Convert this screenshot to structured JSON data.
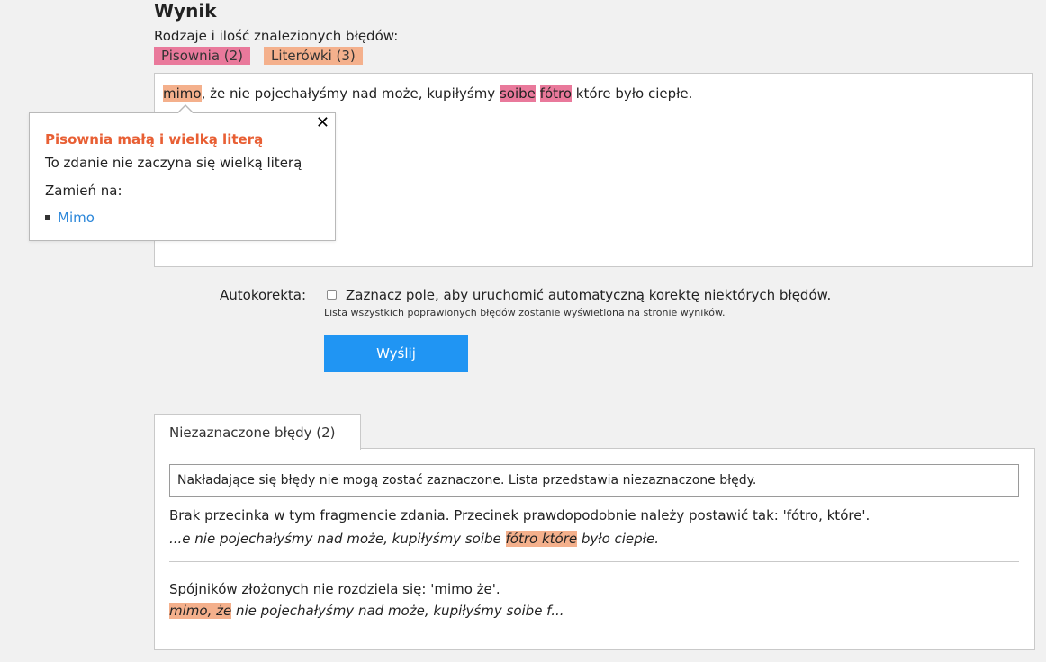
{
  "result": {
    "title": "Wynik",
    "subtitle": "Rodzaje i ilość znalezionych błędów:",
    "badges": {
      "pisownia": "Pisownia (2)",
      "literowki": "Literówki (3)"
    }
  },
  "editor": {
    "seg0": "mimo",
    "seg1": ", że nie pojechałyśmy nad może, kupiłyśmy ",
    "seg2": "soibe",
    "seg3": " ",
    "seg4": "fótro",
    "seg5": " które było ciepłe."
  },
  "popup": {
    "close": "✕",
    "title": "Pisownia małą i wielką literą",
    "message": "To zdanie nie zaczyna się wielką literą",
    "replace_label": "Zamień na:",
    "suggestion": "Mimo"
  },
  "autocorrect": {
    "label": "Autokorekta:",
    "checkbox_text": "Zaznacz pole, aby uruchomić automatyczną korektę niektórych błędów.",
    "note": "Lista wszystkich poprawionych błędów zostanie wyświetlona na stronie wyników."
  },
  "submit_label": "Wyślij",
  "unmarked": {
    "tab_label": "Niezaznaczone błędy (2)",
    "notice": "Nakładające się błędy nie mogą zostać zaznaczone. Lista przedstawia niezaznaczone błędy.",
    "issues": [
      {
        "title": "Brak przecinka w tym fragmencie zdania. Przecinek prawdopodobnie należy postawić tak: 'fótro, które'.",
        "before": "...e nie pojechałyśmy nad może, kupiłyśmy soibe ",
        "highlight": "fótro które",
        "after": " było ciepłe."
      },
      {
        "title": "Spójników złożonych nie rozdziela się: 'mimo że'.",
        "before": "",
        "highlight": "mimo, że",
        "after": " nie pojechałyśmy nad może, kupiłyśmy soibe f..."
      }
    ]
  },
  "colors": {
    "pisownia": "#e9799b",
    "literowki": "#f4b08c",
    "popup_title": "#e85f34",
    "link": "#2a86d9",
    "button": "#2095f3"
  }
}
